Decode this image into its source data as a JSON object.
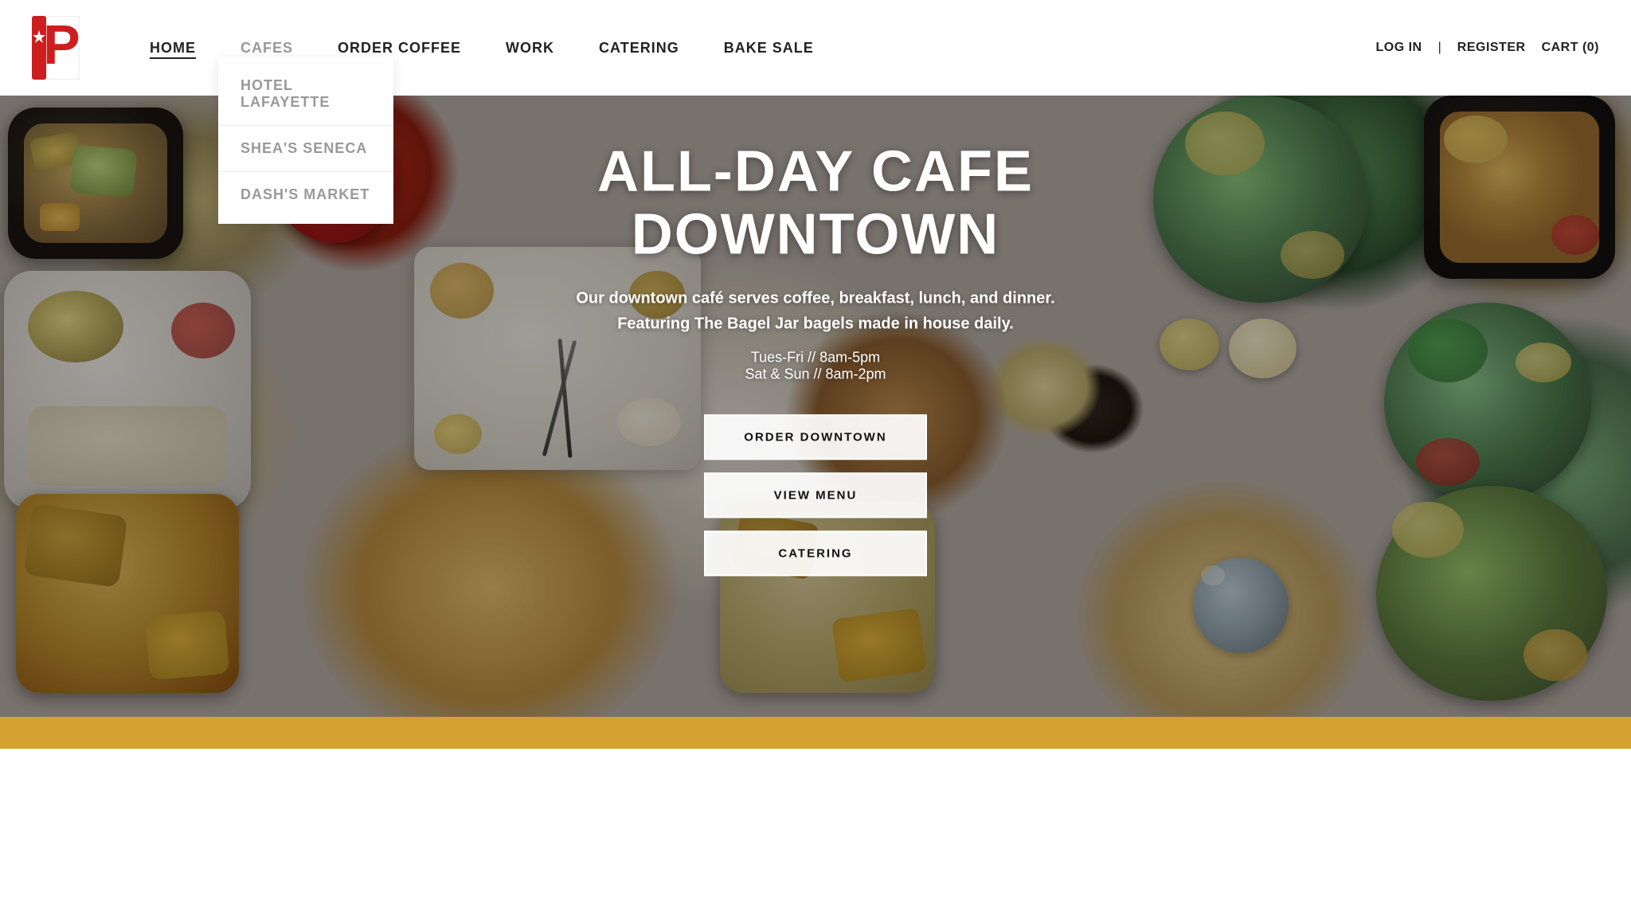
{
  "navbar": {
    "logo_letter": "P",
    "links": [
      {
        "label": "HOME",
        "href": "#",
        "active": true,
        "id": "home"
      },
      {
        "label": "CAFES",
        "href": "#",
        "active": false,
        "id": "cafes",
        "hasDropdown": true
      },
      {
        "label": "ORDER COFFEE",
        "href": "#",
        "active": false,
        "id": "order-coffee"
      },
      {
        "label": "WORK",
        "href": "#",
        "active": false,
        "id": "work"
      },
      {
        "label": "CATERING",
        "href": "#",
        "active": false,
        "id": "catering"
      },
      {
        "label": "BAKE SALE",
        "href": "#",
        "active": false,
        "id": "bake-sale"
      }
    ],
    "dropdown": {
      "items": [
        {
          "label": "HOTEL LAFAYETTE",
          "href": "#"
        },
        {
          "label": "SHEA'S SENECA",
          "href": "#"
        },
        {
          "label": "DASH'S MARKET",
          "href": "#"
        }
      ]
    },
    "login_label": "LOG IN",
    "register_label": "REGISTER",
    "cart_label": "CART (0)"
  },
  "hero": {
    "title": "ALL-DAY CAFE DOWNTOWN",
    "subtitle_line1": "Our downtown café serves coffee, breakfast, lunch, and dinner.",
    "subtitle_line2": "Featuring The Bagel Jar bagels made in house daily.",
    "hours_line1": "Tues-Fri // 8am-5pm",
    "hours_line2": "Sat & Sun // 8am-2pm",
    "buttons": [
      {
        "label": "ORDER DOWNTOWN",
        "id": "order-downtown"
      },
      {
        "label": "VIEW MENU",
        "id": "view-menu"
      },
      {
        "label": "CATERING",
        "id": "catering-btn"
      }
    ]
  },
  "bottom_bar": {
    "color": "#d4a030"
  }
}
